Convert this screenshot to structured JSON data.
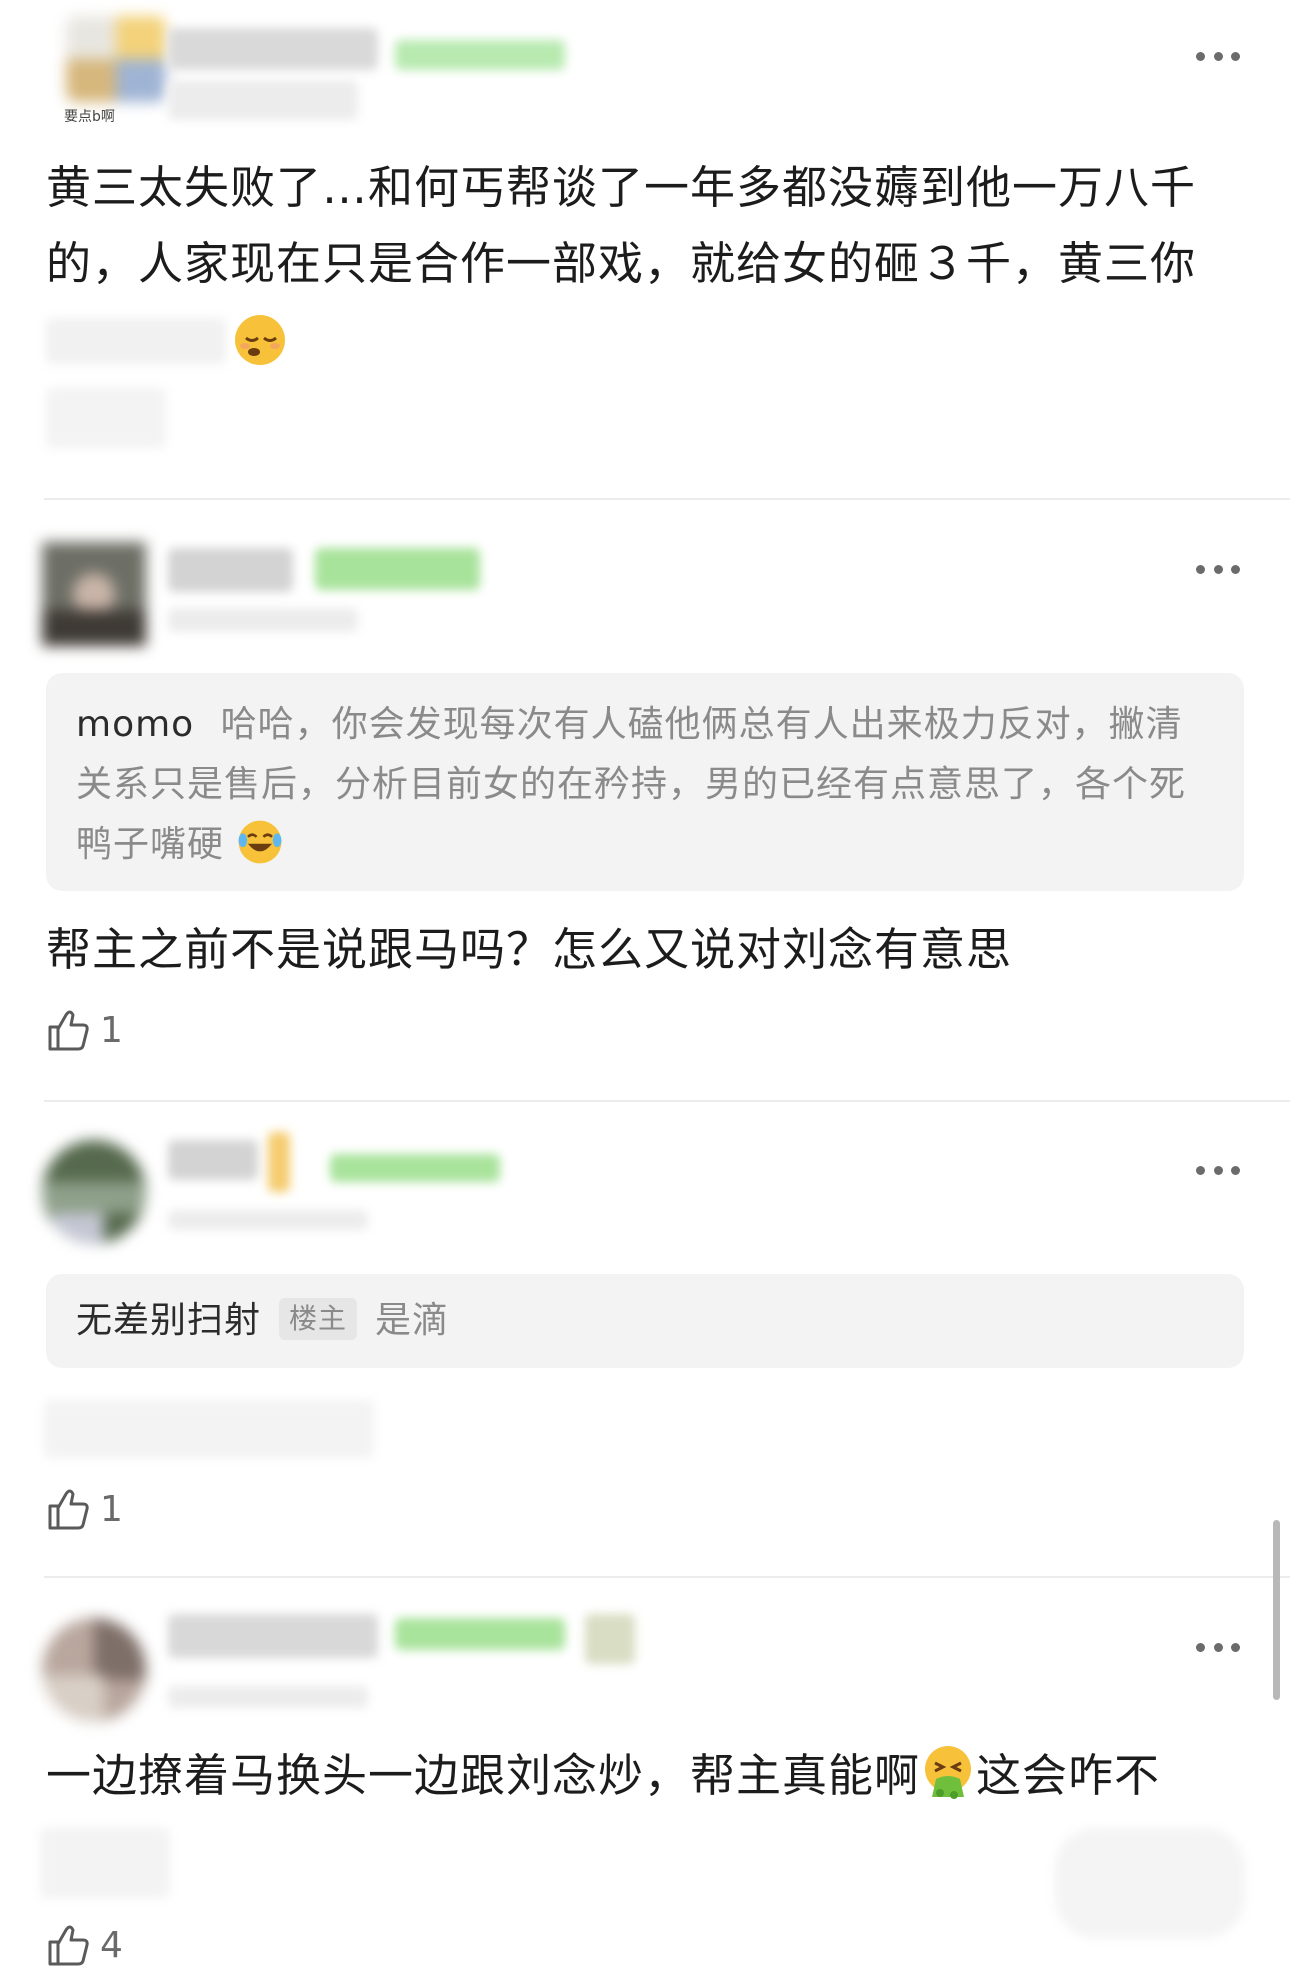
{
  "comments": [
    {
      "avatar_caption": "要点b啊",
      "text_line1": "黄三太失败了…和何丐帮谈了一年多都没薅到他一万八千",
      "text_line2": "的，人家现在只是合作一部戏，就给女的砸３千，黄三你"
    },
    {
      "quote_user": "momo",
      "quote_text": "哈哈，你会发现每次有人磕他俩总有人出来极力反对，撇清关系只是售后，分析目前女的在矜持，男的已经有点意思了，各个死鸭子嘴硬",
      "text": "帮主之前不是说跟马吗？怎么又说对刘念有意思",
      "likes": "1"
    },
    {
      "quote_user": "无差别扫射",
      "quote_tag": "楼主",
      "quote_text": "是滴",
      "likes": "1"
    },
    {
      "text": "一边撩着马换头一边跟刘念炒，帮主真能啊",
      "text_tail": "这会咋不",
      "likes": "4"
    }
  ],
  "icons": [
    "more-icon",
    "thumbs-up-icon",
    "sleepy-emoji-icon",
    "laughing-tears-emoji-icon",
    "vomiting-emoji-icon"
  ],
  "colors": {
    "quote_bg": "#f3f3f3",
    "divider": "#ececec",
    "blur_green": "#9ee08f"
  }
}
